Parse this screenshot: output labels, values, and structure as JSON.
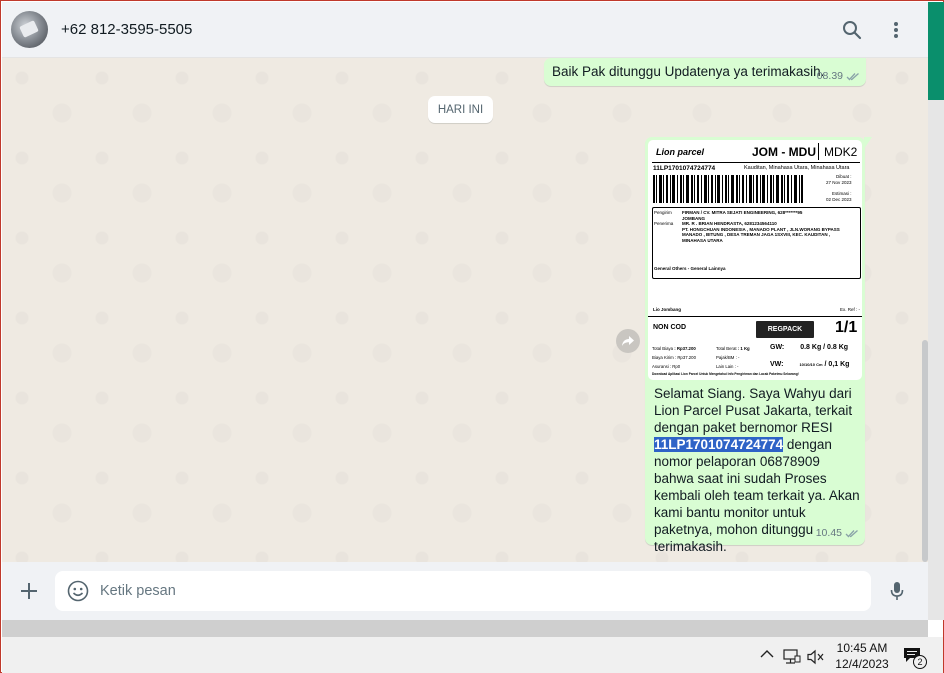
{
  "header": {
    "contact_name": "+62 812-3595-5505",
    "avatar_icon": "contact-avatar",
    "search_icon": "search-icon",
    "menu_icon": "more-vertical-icon"
  },
  "messages": [
    {
      "direction": "outgoing",
      "text": "Baik Pak ditunggu Updatenya ya terimakasih.",
      "time": "08.39",
      "status": "read"
    },
    {
      "direction": "outgoing",
      "type": "image",
      "label": {
        "brand": "Lion parcel",
        "route": "JOM - MDU",
        "code": "MDK2",
        "resi": "11LP1701074724774",
        "destination_area": "Kauditan, Minahasa Utara, Minahasa Utara",
        "dibuat_label": "Dibuat :",
        "dibuat_date": "27 Nov 2023",
        "estimasi_label": "Estimasi :",
        "estimasi_date": "02 Dec 2023",
        "pengirim_label": "Pengirim",
        "pengirim_value": "FIRMAN / CV. MITRA SEJATI ENGINEERING, 628*******95",
        "pengirim_city": "JOMBANG",
        "penerima_label": "Penerima",
        "penerima_value": "MR. R . BRIAN HENDRASTA, 6281234564110",
        "address_1": "PT. HONGCHUAN INDONESIA , MANADO PLANT , JLN.WORANG BYPASS",
        "address_2": "MANADO , BITUNG , DESA TREMAN JAGA 1SXVIII, KEC. KAUDITAN ,",
        "address_3": "MINAHASA UTARA",
        "commodity": "General Others - General Lainnya",
        "origin": "Lio Jombang",
        "ext_ref": "Ex. Ref : -",
        "cod": "NON COD",
        "service": "REGPACK",
        "pieces": "1/1",
        "total_biaya_label": "Total Biaya",
        "total_biaya": ": Rp37.200",
        "total_berat_label": "Total Berat",
        "total_berat": ": 1 Kg",
        "biaya_kirim_label": "Biaya Kirim",
        "biaya_kirim": ": Rp37.200",
        "pajak_label": "Pajak/BM",
        "pajak": ": -",
        "asuransi_label": "Asuransi",
        "asuransi": ": Rp0",
        "lain_label": "Lain Lain",
        "lain": ": -",
        "gw_label": "GW:",
        "gw": "0.8 Kg / 0.8 Kg",
        "vw_label": "VW:",
        "vw_dims": "10/10/10 Cm",
        "vw": "/ 0,1 Kg",
        "footer_note": "Download Aplikasi Lion Parcel Untuk Mengetahui Info Pengiriman dan Lacak Paketmu Sekarang!"
      },
      "caption_before": "Selamat Siang. Saya Wahyu dari Lion Parcel Pusat Jakarta, terkait dengan paket bernomor RESI ",
      "caption_highlight": "11LP1701074724774",
      "caption_after": " dengan nomor pelaporan 06878909 bahwa saat ini sudah Proses kembali oleh team terkait ya. Akan kami bantu monitor untuk paketnya, mohon ditunggu terimakasih.",
      "time": "10.45",
      "status": "read"
    }
  ],
  "day_divider": "HARI INI",
  "composer": {
    "placeholder": "Ketik pesan",
    "attach_icon": "plus-icon",
    "emoji_icon": "emoji-icon",
    "mic_icon": "microphone-icon"
  },
  "taskbar": {
    "time": "10:45 AM",
    "date": "12/4/2023",
    "notification_count": "2",
    "tray_icons": [
      "chevron-up-icon",
      "network-icon",
      "volume-muted-icon",
      "notification-icon"
    ]
  },
  "colors": {
    "chat_bg": "#efeae2",
    "outgoing_bubble": "#d9fdd3",
    "header_bg": "#f0f2f5",
    "highlight": "#2e63c7",
    "accent_green": "#0a8f6c"
  }
}
